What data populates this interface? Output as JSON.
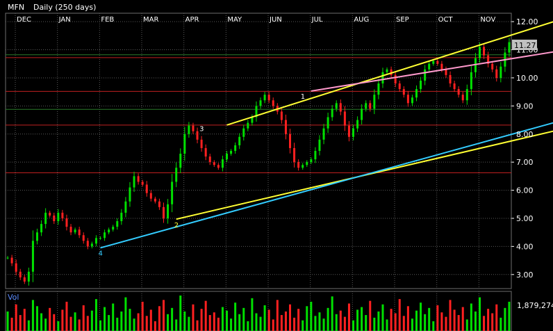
{
  "chart_data": {
    "type": "candlestick",
    "title": "MFN",
    "subtitle": "Daily (250 days)",
    "months": [
      "DEC",
      "JAN",
      "FEB",
      "MAR",
      "APR",
      "MAY",
      "JUN",
      "JUL",
      "AUG",
      "SEP",
      "OCT",
      "NOV"
    ],
    "y_ticks": [
      "3.00",
      "4.00",
      "5.00",
      "6.00",
      "7.00",
      "8.00",
      "9.00",
      "10.00",
      "11.00",
      "12.00"
    ],
    "ylim": [
      2.5,
      12.3
    ],
    "last_price": "11.27",
    "volume_label": "Vol",
    "volume_value": "1,879,274",
    "grid": true,
    "horizontal_lines": [
      {
        "y": 10.72,
        "color": "#c02020"
      },
      {
        "y": 10.82,
        "color": "#2a7a2a"
      },
      {
        "y": 9.52,
        "color": "#c02020"
      },
      {
        "y": 8.88,
        "color": "#2a7a2a"
      },
      {
        "y": 8.32,
        "color": "#c02020"
      },
      {
        "y": 6.62,
        "color": "#c02020"
      }
    ],
    "trendlines": [
      {
        "color": "#ffff33",
        "from": [
          52,
          8.32
        ],
        "to": [
          130,
          12.02
        ]
      },
      {
        "color": "#ffff33",
        "from": [
          40,
          4.97
        ],
        "to": [
          150,
          8.82
        ]
      },
      {
        "color": "#ff99cc",
        "from": [
          72,
          9.53
        ],
        "to": [
          150,
          11.42
        ]
      },
      {
        "color": "#33ccff",
        "from": [
          22,
          3.95
        ],
        "to": [
          150,
          9.25
        ]
      }
    ],
    "wave_labels": [
      {
        "text": "4",
        "x": 22,
        "y": 3.78,
        "color": "#33ccff"
      },
      {
        "text": "2",
        "x": 40,
        "y": 4.78,
        "color": "#ffff33"
      },
      {
        "text": "3",
        "x": 46,
        "y": 8.2,
        "color": "#ffffff"
      },
      {
        "text": "1",
        "x": 70,
        "y": 9.35,
        "color": "#ffffff"
      }
    ],
    "series": [
      {
        "name": "close",
        "values": [
          3.6,
          3.4,
          3.1,
          2.9,
          2.75,
          3.1,
          4.2,
          4.5,
          4.8,
          5.2,
          5.1,
          4.9,
          5.2,
          5.0,
          4.7,
          4.5,
          4.6,
          4.4,
          4.2,
          4.0,
          4.1,
          4.3,
          4.3,
          4.5,
          4.6,
          4.7,
          4.9,
          5.2,
          5.6,
          6.1,
          6.5,
          6.3,
          6.2,
          5.9,
          5.7,
          5.6,
          5.4,
          5.0,
          5.5,
          6.3,
          6.8,
          7.3,
          8.0,
          8.3,
          8.1,
          7.8,
          7.5,
          7.2,
          7.0,
          6.9,
          6.8,
          7.1,
          7.3,
          7.4,
          7.6,
          7.9,
          8.2,
          8.4,
          8.6,
          9.0,
          9.2,
          9.4,
          9.2,
          9.0,
          8.8,
          8.5,
          8.0,
          7.5,
          7.0,
          6.8,
          6.9,
          7.0,
          7.1,
          7.4,
          7.8,
          8.2,
          8.6,
          8.9,
          9.1,
          8.8,
          8.3,
          7.9,
          8.2,
          8.5,
          8.9,
          9.1,
          8.9,
          9.4,
          9.8,
          10.2,
          10.3,
          10.1,
          9.8,
          9.6,
          9.4,
          9.1,
          9.3,
          9.6,
          9.9,
          10.3,
          10.5,
          10.6,
          10.5,
          10.3,
          10.1,
          9.8,
          9.6,
          9.4,
          9.2,
          9.6,
          10.2,
          10.7,
          11.1,
          10.8,
          10.5,
          10.3,
          10.0,
          10.4,
          10.9,
          11.27
        ]
      },
      {
        "name": "volume",
        "values": [
          22,
          15,
          30,
          18,
          25,
          12,
          35,
          28,
          20,
          14,
          26,
          19,
          11,
          24,
          33,
          16,
          21,
          13,
          29,
          17,
          23,
          36,
          12,
          27,
          18,
          31,
          15,
          22,
          38,
          25,
          14,
          20,
          33,
          17,
          24,
          11,
          28,
          35,
          19,
          26,
          13,
          40,
          22,
          16,
          30,
          12,
          25,
          34,
          18,
          21,
          15,
          27,
          23,
          14,
          32,
          19,
          26,
          11,
          37,
          20,
          16,
          29,
          24,
          13,
          35,
          18,
          22,
          30,
          15,
          25,
          12,
          28,
          33,
          17,
          21,
          14,
          26,
          39,
          19,
          23,
          16,
          31,
          12,
          24,
          27,
          18,
          34,
          15,
          22,
          30,
          13,
          25,
          20,
          36,
          17,
          28,
          14,
          23,
          32,
          19,
          26,
          11,
          29,
          21,
          16,
          35,
          24,
          18,
          27,
          13,
          31,
          22,
          38,
          17,
          25,
          20,
          30,
          15,
          26,
          33
        ]
      }
    ]
  }
}
